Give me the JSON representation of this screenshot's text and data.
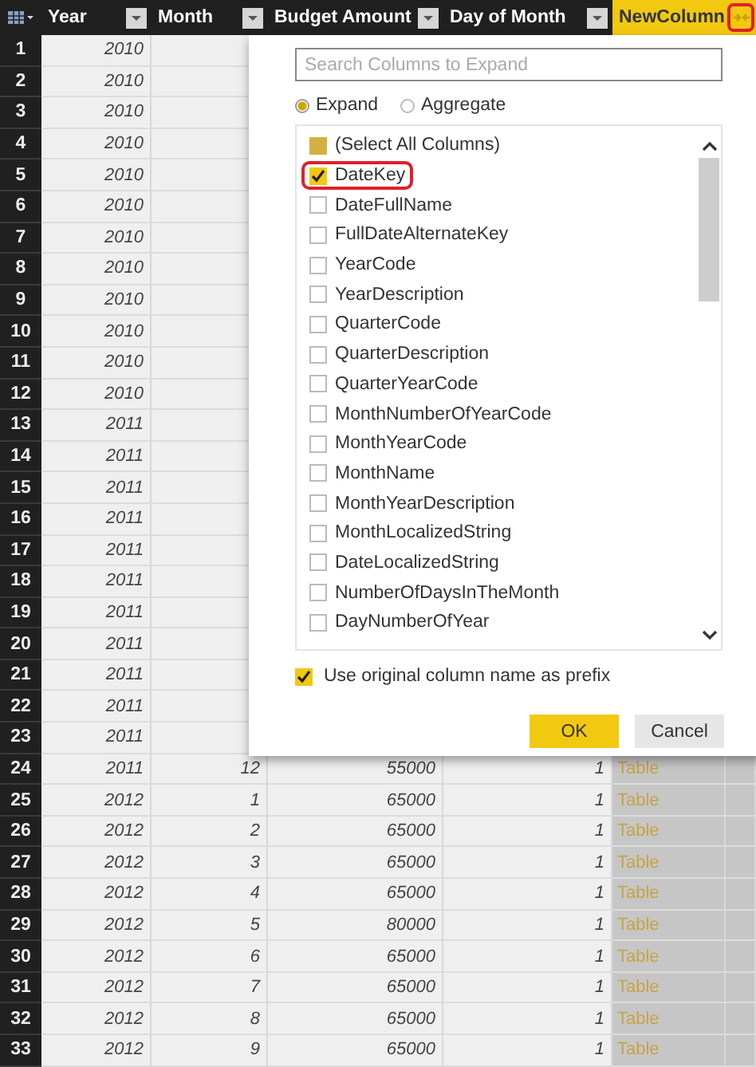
{
  "table": {
    "columns": [
      {
        "label": "Year",
        "selected": false
      },
      {
        "label": "Month",
        "selected": false
      },
      {
        "label": "Budget Amount",
        "selected": false
      },
      {
        "label": "Day of Month",
        "selected": false
      },
      {
        "label": "NewColumn",
        "selected": true
      }
    ],
    "expand_button": {
      "highlighted": true
    },
    "rows": [
      {
        "number": "1",
        "cells": [
          "2010"
        ]
      },
      {
        "number": "2",
        "cells": [
          "2010"
        ]
      },
      {
        "number": "3",
        "cells": [
          "2010"
        ]
      },
      {
        "number": "4",
        "cells": [
          "2010"
        ]
      },
      {
        "number": "5",
        "cells": [
          "2010"
        ]
      },
      {
        "number": "6",
        "cells": [
          "2010"
        ]
      },
      {
        "number": "7",
        "cells": [
          "2010"
        ]
      },
      {
        "number": "8",
        "cells": [
          "2010"
        ]
      },
      {
        "number": "9",
        "cells": [
          "2010"
        ]
      },
      {
        "number": "10",
        "cells": [
          "2010"
        ]
      },
      {
        "number": "11",
        "cells": [
          "2010"
        ]
      },
      {
        "number": "12",
        "cells": [
          "2010"
        ]
      },
      {
        "number": "13",
        "cells": [
          "2011"
        ]
      },
      {
        "number": "14",
        "cells": [
          "2011"
        ]
      },
      {
        "number": "15",
        "cells": [
          "2011"
        ]
      },
      {
        "number": "16",
        "cells": [
          "2011"
        ]
      },
      {
        "number": "17",
        "cells": [
          "2011"
        ]
      },
      {
        "number": "18",
        "cells": [
          "2011"
        ]
      },
      {
        "number": "19",
        "cells": [
          "2011"
        ]
      },
      {
        "number": "20",
        "cells": [
          "2011"
        ]
      },
      {
        "number": "21",
        "cells": [
          "2011"
        ]
      },
      {
        "number": "22",
        "cells": [
          "2011"
        ]
      },
      {
        "number": "23",
        "cells": [
          "2011"
        ]
      },
      {
        "number": "24",
        "cells": [
          "2011",
          "12",
          "55000",
          "1",
          "Table"
        ]
      },
      {
        "number": "25",
        "cells": [
          "2012",
          "1",
          "65000",
          "1",
          "Table"
        ]
      },
      {
        "number": "26",
        "cells": [
          "2012",
          "2",
          "65000",
          "1",
          "Table"
        ]
      },
      {
        "number": "27",
        "cells": [
          "2012",
          "3",
          "65000",
          "1",
          "Table"
        ]
      },
      {
        "number": "28",
        "cells": [
          "2012",
          "4",
          "65000",
          "1",
          "Table"
        ]
      },
      {
        "number": "29",
        "cells": [
          "2012",
          "5",
          "80000",
          "1",
          "Table"
        ]
      },
      {
        "number": "30",
        "cells": [
          "2012",
          "6",
          "65000",
          "1",
          "Table"
        ]
      },
      {
        "number": "31",
        "cells": [
          "2012",
          "7",
          "65000",
          "1",
          "Table"
        ]
      },
      {
        "number": "32",
        "cells": [
          "2012",
          "8",
          "65000",
          "1",
          "Table"
        ]
      },
      {
        "number": "33",
        "cells": [
          "2012",
          "9",
          "65000",
          "1",
          "Table"
        ]
      }
    ]
  },
  "expand_dialog": {
    "search": {
      "placeholder": "Search Columns to Expand"
    },
    "modes": [
      {
        "label": "Expand",
        "selected": true
      },
      {
        "label": "Aggregate",
        "selected": false
      }
    ],
    "select_all": {
      "label": "(Select All Columns)",
      "mixed": true
    },
    "columns": [
      {
        "label": "DateKey",
        "checked": true,
        "highlighted": true
      },
      {
        "label": "DateFullName",
        "checked": false,
        "highlighted": false
      },
      {
        "label": "FullDateAlternateKey",
        "checked": false,
        "highlighted": false
      },
      {
        "label": "YearCode",
        "checked": false,
        "highlighted": false
      },
      {
        "label": "YearDescription",
        "checked": false,
        "highlighted": false
      },
      {
        "label": "QuarterCode",
        "checked": false,
        "highlighted": false
      },
      {
        "label": "QuarterDescription",
        "checked": false,
        "highlighted": false
      },
      {
        "label": "QuarterYearCode",
        "checked": false,
        "highlighted": false
      },
      {
        "label": "MonthNumberOfYearCode",
        "checked": false,
        "highlighted": false
      },
      {
        "label": "MonthYearCode",
        "checked": false,
        "highlighted": false
      },
      {
        "label": "MonthName",
        "checked": false,
        "highlighted": false
      },
      {
        "label": "MonthYearDescription",
        "checked": false,
        "highlighted": false
      },
      {
        "label": "MonthLocalizedString",
        "checked": false,
        "highlighted": false
      },
      {
        "label": "DateLocalizedString",
        "checked": false,
        "highlighted": false
      },
      {
        "label": "NumberOfDaysInTheMonth",
        "checked": false,
        "highlighted": false
      },
      {
        "label": "DayNumberOfYear",
        "checked": false,
        "highlighted": false
      }
    ],
    "prefix_option": {
      "label": "Use original column name as prefix",
      "checked": true
    },
    "buttons": [
      {
        "label": "OK",
        "kind": "primary"
      },
      {
        "label": "Cancel",
        "kind": "secondary"
      }
    ]
  }
}
